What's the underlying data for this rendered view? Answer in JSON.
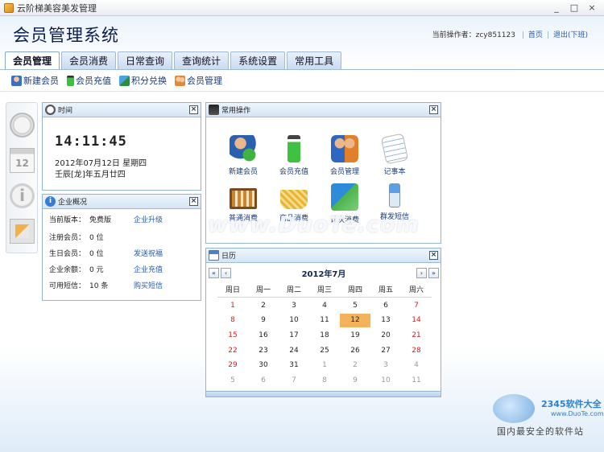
{
  "window": {
    "title": "云阶梯美容美发管理",
    "minimize": "_",
    "maximize": "□",
    "close": "×"
  },
  "app_title": "会员管理系统",
  "operator": {
    "label": "当前操作者：",
    "name": "zcy851123",
    "home": "首页",
    "logout": "退出(下班)",
    "sep": "|"
  },
  "tabs": [
    "会员管理",
    "会员消费",
    "日常查询",
    "查询统计",
    "系统设置",
    "常用工具"
  ],
  "active_tab": "会员管理",
  "subtoolbar": [
    "新建会员",
    "会员充值",
    "积分兑换",
    "会员管理"
  ],
  "time_panel": {
    "title": "时间",
    "clock": "14:11:45",
    "date": "2012年07月12日  星期四",
    "lunar": "壬辰[龙]年五月廿四"
  },
  "company_panel": {
    "title": "企业概况",
    "rows": [
      {
        "label": "当前版本：",
        "value": "免费版",
        "link": "企业升级"
      },
      {
        "label": "注册会员：",
        "value": "0 位",
        "link": ""
      },
      {
        "label": "生日会员：",
        "value": "0 位",
        "link": "发送祝福"
      },
      {
        "label": "企业余额：",
        "value": "0 元",
        "link": "企业充值"
      },
      {
        "label": "可用短信：",
        "value": "10 条",
        "link": "购买短信"
      }
    ]
  },
  "ops_panel": {
    "title": "常用操作",
    "items": [
      "新建会员",
      "会员充值",
      "会员管理",
      "记事本",
      "普通消费",
      "商品消费",
      "计次消费",
      "群发短信"
    ]
  },
  "calendar": {
    "title": "日历",
    "month": "2012年7月",
    "nav": {
      "prev_year": "«",
      "prev_month": "‹",
      "next_month": "›",
      "next_year": "»"
    },
    "weekdays": [
      "周日",
      "周一",
      "周二",
      "周三",
      "周四",
      "周五",
      "周六"
    ],
    "weeks": [
      [
        "1",
        "2",
        "3",
        "4",
        "5",
        "6",
        "7"
      ],
      [
        "8",
        "9",
        "10",
        "11",
        "12",
        "13",
        "14"
      ],
      [
        "15",
        "16",
        "17",
        "18",
        "19",
        "20",
        "21"
      ],
      [
        "22",
        "23",
        "24",
        "25",
        "26",
        "27",
        "28"
      ],
      [
        "29",
        "30",
        "31",
        "1",
        "2",
        "3",
        "4"
      ],
      [
        "5",
        "6",
        "7",
        "8",
        "9",
        "10",
        "11"
      ]
    ],
    "today": "12"
  },
  "watermark": "www.DuoTe.com",
  "logo": {
    "brand": "2345软件大全",
    "url": "www.DuoTe.com",
    "slogan": "国内最安全的软件站"
  },
  "colors": {
    "accent": "#2b5aa4",
    "today_bg": "#f4b35a",
    "weekend_red": "#cc2020",
    "panel_border": "#94b4d4"
  }
}
